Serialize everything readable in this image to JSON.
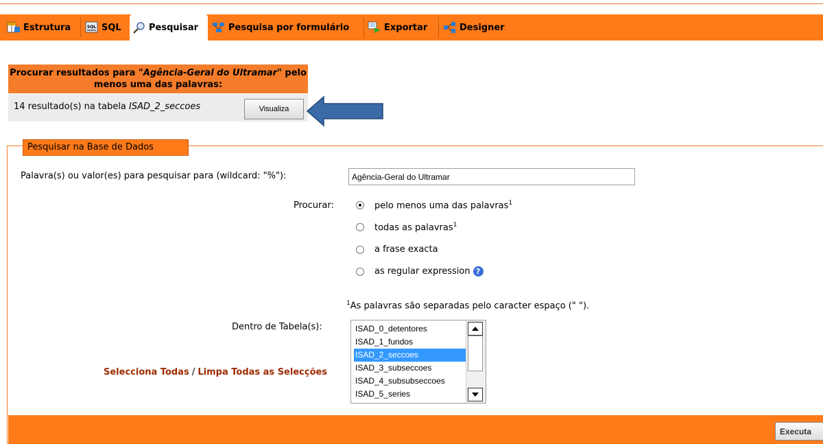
{
  "tabs": [
    {
      "label": "Estrutura",
      "icon": "table-structure-icon"
    },
    {
      "label": "SQL",
      "icon": "sql-icon"
    },
    {
      "label": "Pesquisar",
      "icon": "magnifier-icon",
      "active": true
    },
    {
      "label": "Pesquisa por formulário",
      "icon": "query-form-icon"
    },
    {
      "label": "Exportar",
      "icon": "export-icon"
    },
    {
      "label": "Designer",
      "icon": "designer-icon"
    }
  ],
  "results": {
    "header_prefix": "Procurar resultados para \"",
    "header_term": "Agência-Geral do Ultramar",
    "header_suffix": "\" pelo menos uma das palavras:",
    "count_text": "14 resultado(s) na tabela ",
    "table_name": "ISAD_2_seccoes",
    "view_button": "Visualiza"
  },
  "form": {
    "legend": "Pesquisar na Base de Dados",
    "search_label": "Palavra(s) ou valor(es) para pesquisar para (wildcard: \"%\"):",
    "search_value": "Agência-Geral do Ultramar",
    "find_label": "Procurar:",
    "options": [
      {
        "label": "pelo menos uma das palavras",
        "sup": "1",
        "checked": true
      },
      {
        "label": "todas as palavras",
        "sup": "1",
        "checked": false
      },
      {
        "label": "a frase exacta",
        "sup": "",
        "checked": false
      },
      {
        "label": "as regular expression",
        "sup": "",
        "checked": false
      }
    ],
    "footnote_sup": "1",
    "footnote": "As palavras são separadas pelo caracter espaço (\" \").",
    "tables_label": "Dentro de Tabela(s):",
    "tables": [
      "ISAD_0_detentores",
      "ISAD_1_fundos",
      "ISAD_2_seccoes",
      "ISAD_3_subseccoes",
      "ISAD_4_subsubseccoes",
      "ISAD_5_series"
    ],
    "selected_table": "ISAD_2_seccoes",
    "select_all": "Selecciona Todas",
    "separator": " / ",
    "clear_all": "Limpa Todas as Selecções",
    "submit": "Executa"
  },
  "colors": {
    "accent": "#ff7a18",
    "link": "#9c2b00",
    "arrow": "#3a6aa8",
    "selection": "#3399ff"
  }
}
